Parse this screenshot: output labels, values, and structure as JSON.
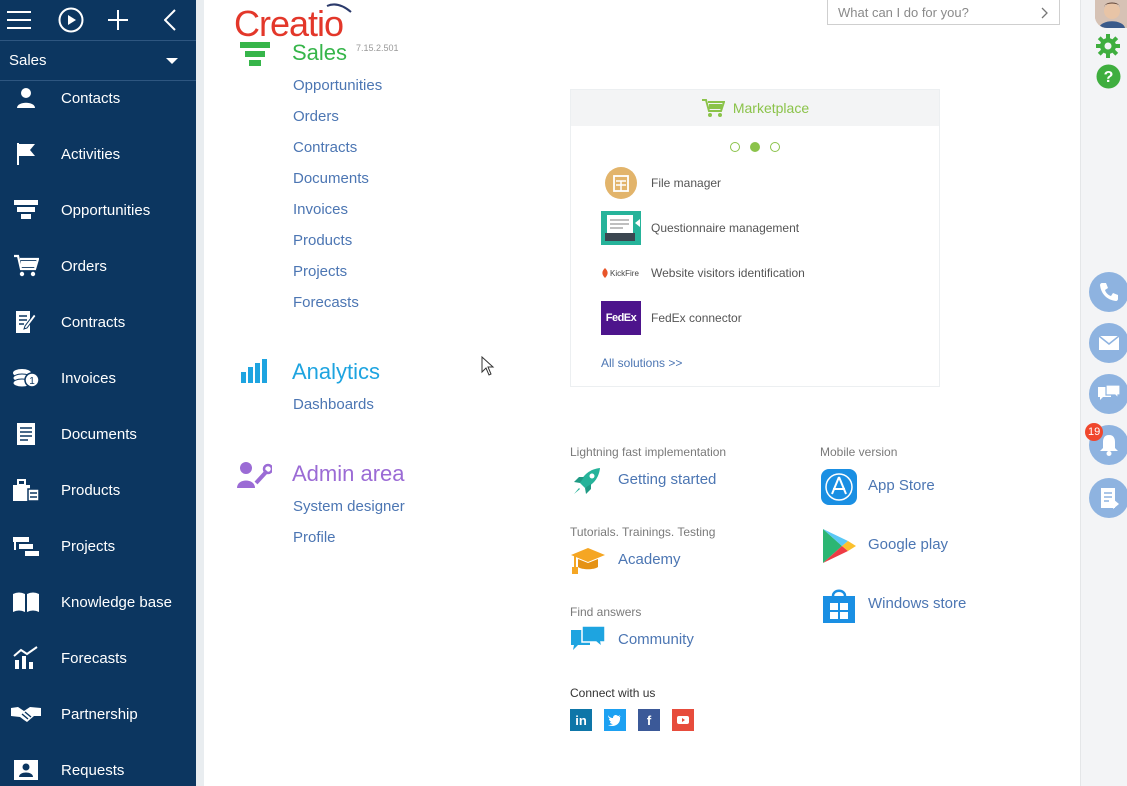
{
  "sidebar": {
    "workspace": "Sales",
    "items": [
      {
        "label": "Contacts",
        "icon": "contact-icon"
      },
      {
        "label": "Activities",
        "icon": "flag-icon"
      },
      {
        "label": "Opportunities",
        "icon": "funnel-icon"
      },
      {
        "label": "Orders",
        "icon": "cart-icon"
      },
      {
        "label": "Contracts",
        "icon": "contract-icon"
      },
      {
        "label": "Invoices",
        "icon": "coins-icon"
      },
      {
        "label": "Documents",
        "icon": "document-icon"
      },
      {
        "label": "Products",
        "icon": "products-icon"
      },
      {
        "label": "Projects",
        "icon": "projects-icon"
      },
      {
        "label": "Knowledge base",
        "icon": "book-icon"
      },
      {
        "label": "Forecasts",
        "icon": "forecast-icon"
      },
      {
        "label": "Partnership",
        "icon": "handshake-icon"
      },
      {
        "label": "Requests",
        "icon": "request-icon"
      }
    ]
  },
  "header": {
    "logo": "Creatio",
    "version": "7.15.2.501",
    "search_placeholder": "What can I do for you?"
  },
  "sections": {
    "sales": {
      "title": "Sales",
      "links": [
        "Opportunities",
        "Orders",
        "Contracts",
        "Documents",
        "Invoices",
        "Products",
        "Projects",
        "Forecasts"
      ]
    },
    "analytics": {
      "title": "Analytics",
      "links": [
        "Dashboards"
      ]
    },
    "admin": {
      "title": "Admin area",
      "links": [
        "System designer",
        "Profile"
      ]
    }
  },
  "marketplace": {
    "title": "Marketplace",
    "items": [
      {
        "label": "File manager",
        "icon": "file-manager-icon"
      },
      {
        "label": "Questionnaire management",
        "icon": "questionnaire-icon"
      },
      {
        "label": "Website visitors identification",
        "icon": "kickfire-logo-icon",
        "logo_text": "KickFire"
      },
      {
        "label": "FedEx connector",
        "icon": "fedex-logo-icon",
        "logo_text": "FedEx"
      }
    ],
    "all_link": "All solutions >>",
    "active_dot": 2
  },
  "resources": {
    "implementation": {
      "caption": "Lightning fast implementation",
      "link": "Getting started"
    },
    "tutorials": {
      "caption": "Tutorials. Trainings. Testing",
      "link": "Academy"
    },
    "answers": {
      "caption": "Find answers",
      "link": "Community"
    },
    "mobile": {
      "caption": "Mobile version",
      "links": [
        "App Store",
        "Google play",
        "Windows store"
      ]
    },
    "connect": {
      "caption": "Connect with us",
      "networks": [
        "linkedin-icon",
        "twitter-icon",
        "facebook-icon",
        "youtube-icon"
      ]
    }
  },
  "right_panel": {
    "notifications_count": "19"
  },
  "colors": {
    "sidebar": "#0c3660",
    "sales": "#36b54a",
    "analytics": "#1ea4e0",
    "admin": "#9b6bd5",
    "link": "#4c76b3",
    "accent_green": "#8bc34a"
  }
}
